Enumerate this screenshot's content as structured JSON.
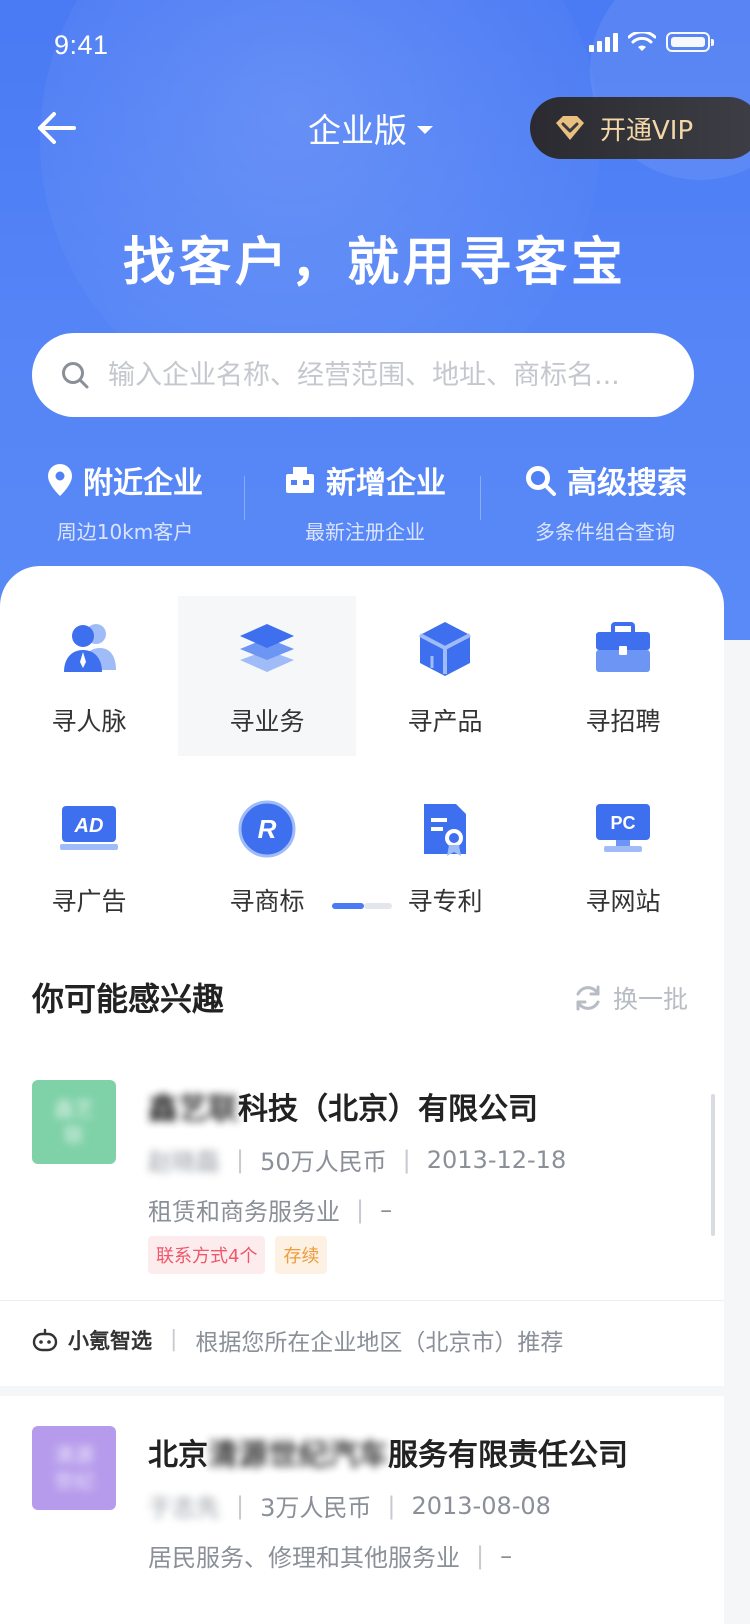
{
  "status_bar": {
    "time": "9:41"
  },
  "header": {
    "edition": "企业版",
    "vip_label": "开通VIP"
  },
  "hero": {
    "slogan": "找客户，就用寻客宝"
  },
  "search": {
    "placeholder": "输入企业名称、经营范围、地址、商标名..."
  },
  "quick_links": [
    {
      "title": "附近企业",
      "subtitle": "周边10km客户",
      "icon": "location-pin-icon"
    },
    {
      "title": "新增企业",
      "subtitle": "最新注册企业",
      "icon": "building-icon"
    },
    {
      "title": "高级搜索",
      "subtitle": "多条件组合查询",
      "icon": "magnifier-icon"
    }
  ],
  "categories": [
    {
      "label": "寻人脉",
      "icon": "people-icon"
    },
    {
      "label": "寻业务",
      "icon": "layers-icon"
    },
    {
      "label": "寻产品",
      "icon": "cube-icon"
    },
    {
      "label": "寻招聘",
      "icon": "briefcase-icon"
    },
    {
      "label": "寻广告",
      "icon": "ad-icon"
    },
    {
      "label": "寻商标",
      "icon": "trademark-icon"
    },
    {
      "label": "寻专利",
      "icon": "patent-certificate-icon"
    },
    {
      "label": "寻网站",
      "icon": "pc-website-icon"
    }
  ],
  "recommend": {
    "title": "你可能感兴趣",
    "refresh_label": "换一批",
    "companies": [
      {
        "logo_text": "鑫艺联",
        "name_hidden": "鑫艺联",
        "name_visible": "科技（北京）有限公司",
        "person": "赵晓磊",
        "capital": "50万人民币",
        "date": "2013-12-18",
        "industry": "租赁和商务服务业",
        "industry_extra": "–",
        "tags": [
          "联系方式4个",
          "存续"
        ],
        "logo_color": "#7fd1a8"
      },
      {
        "logo_text": "清源世纪",
        "name_prefix": "北京",
        "name_hidden": "清源世纪汽车",
        "name_visible": "服务有限责任公司",
        "person": "于志先",
        "capital": "3万人民币",
        "date": "2013-08-08",
        "industry": "居民服务、修理和其他服务业",
        "industry_extra": "–",
        "logo_color": "#b69bec"
      }
    ],
    "source": {
      "brand": "小氪智选",
      "desc": "根据您所在企业地区（北京市）推荐"
    }
  },
  "colors": {
    "primary": "#4a7af4",
    "vip_gold": "#f3d7a6",
    "tag_red": "#f0576b",
    "tag_orange": "#f09a3a"
  }
}
